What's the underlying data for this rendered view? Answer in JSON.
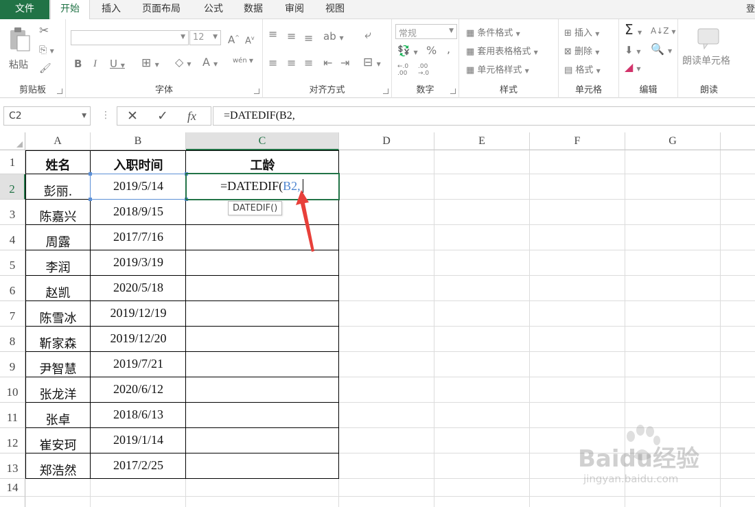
{
  "menu": {
    "file": "文件",
    "tabs": [
      "开始",
      "插入",
      "页面布局",
      "公式",
      "数据",
      "审阅",
      "视图"
    ],
    "cut_text": "登"
  },
  "ribbon": {
    "clipboard": {
      "label": "剪贴板",
      "paste": "粘贴"
    },
    "font": {
      "label": "字体",
      "font_size": "12",
      "phonetic": "wén"
    },
    "alignment": {
      "label": "对齐方式"
    },
    "number": {
      "label": "数字",
      "format": "常规"
    },
    "styles": {
      "label": "样式",
      "conditional": "条件格式",
      "table_format": "套用表格格式",
      "cell_style": "单元格样式"
    },
    "cells": {
      "label": "单元格",
      "insert": "插入",
      "delete": "删除",
      "format": "格式"
    },
    "editing": {
      "label": "编辑"
    },
    "read": {
      "label": "朗读",
      "read_cell": "朗读单元格"
    }
  },
  "formula_bar": {
    "name_box": "C2",
    "fx": "fx",
    "formula": "=DATEDIF(B2,"
  },
  "sheet": {
    "columns": [
      "A",
      "B",
      "C",
      "D",
      "E",
      "F",
      "G"
    ],
    "selected_column": "C",
    "rows": [
      "1",
      "2",
      "3",
      "4",
      "5",
      "6",
      "7",
      "8",
      "9",
      "10",
      "11",
      "12",
      "13",
      "14"
    ],
    "selected_row": "2",
    "headers": {
      "name": "姓名",
      "date": "入职时间",
      "seniority": "工龄"
    },
    "records": [
      {
        "name": "彭丽.",
        "date": "2019/5/14"
      },
      {
        "name": "陈嘉兴",
        "date": "2018/9/15"
      },
      {
        "name": "周露",
        "date": "2017/7/16"
      },
      {
        "name": "李润",
        "date": "2019/3/19"
      },
      {
        "name": "赵凯",
        "date": "2020/5/18"
      },
      {
        "name": "陈雪冰",
        "date": "2019/12/19"
      },
      {
        "name": "靳家森",
        "date": "2019/12/20"
      },
      {
        "name": "尹智慧",
        "date": "2019/7/21"
      },
      {
        "name": "张龙洋",
        "date": "2020/6/12"
      },
      {
        "name": "张卓",
        "date": "2018/6/13"
      },
      {
        "name": "崔安珂",
        "date": "2019/1/14"
      },
      {
        "name": "郑浩然",
        "date": "2017/2/25"
      }
    ],
    "edit_cell": {
      "prefix": "=DATEDIF(",
      "ref": "B2,",
      "tooltip": "DATEDIF()"
    }
  },
  "watermark": {
    "brand": "Baidu经验",
    "url": "jingyan.baidu.com"
  },
  "colors": {
    "accent": "#217346",
    "ref": "#4f86d0",
    "arrow": "#e8403a"
  }
}
